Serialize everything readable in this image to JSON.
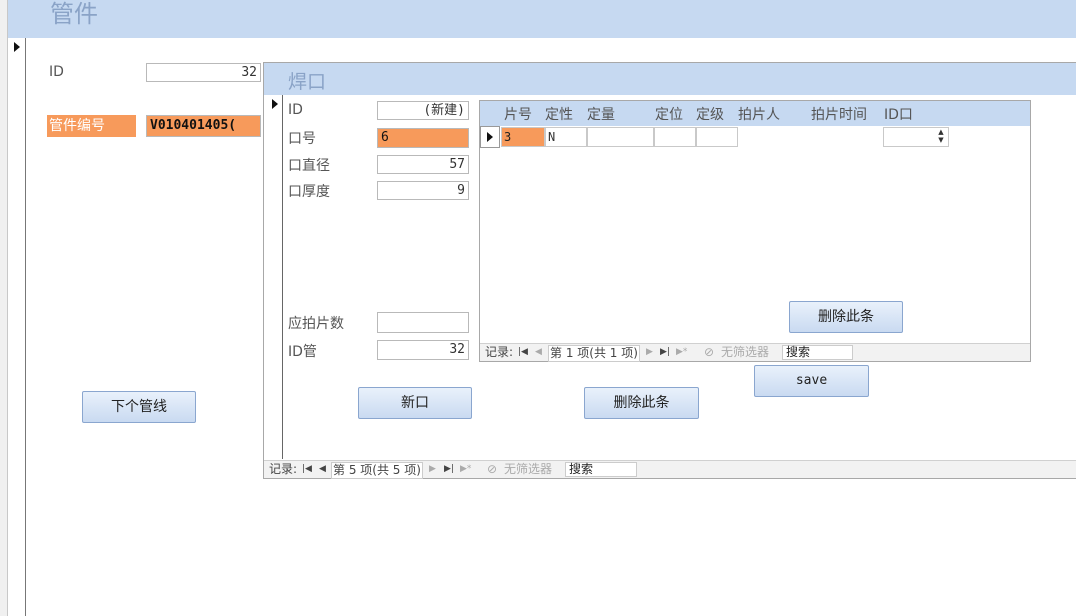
{
  "form": {
    "title": "管件",
    "fields": {
      "id_label": "ID",
      "id_value": "32",
      "code_label": "管件编号",
      "code_value": "V010401405("
    },
    "next_button": "下个管线",
    "nav": {
      "record_label": "记录:",
      "position": "第 5 项(共 5 项)",
      "filter": "无筛选器",
      "search": "搜索"
    }
  },
  "weld": {
    "title": "焊口",
    "fields": {
      "id_label": "ID",
      "id_value": "(新建)",
      "no_label": "口号",
      "no_value": "6",
      "diameter_label": "口直径",
      "diameter_value": "57",
      "thickness_label": "口厚度",
      "thickness_value": "9",
      "films_label": "应拍片数",
      "films_value": "",
      "idpipe_label": "ID管",
      "idpipe_value": "32"
    },
    "new_button": "新口",
    "delete_button": "删除此条"
  },
  "film": {
    "columns": [
      "片号",
      "定性",
      "定量",
      "定位",
      "定级",
      "拍片人",
      "拍片时间",
      "ID口"
    ],
    "row": {
      "film_no": "3",
      "quality": "N",
      "quantity": "",
      "position": "",
      "grade": "",
      "shooter": "",
      "time": "",
      "id_weld": ""
    },
    "delete_button": "删除此条",
    "nav": {
      "record_label": "记录:",
      "position": "第 1 项(共 1 项)",
      "filter": "无筛选器",
      "search": "搜索"
    }
  },
  "save_button": "save",
  "colors": {
    "header_bg": "#c6d9f1",
    "highlight": "#f79a5b",
    "button_bg": "#d6e3f5"
  }
}
